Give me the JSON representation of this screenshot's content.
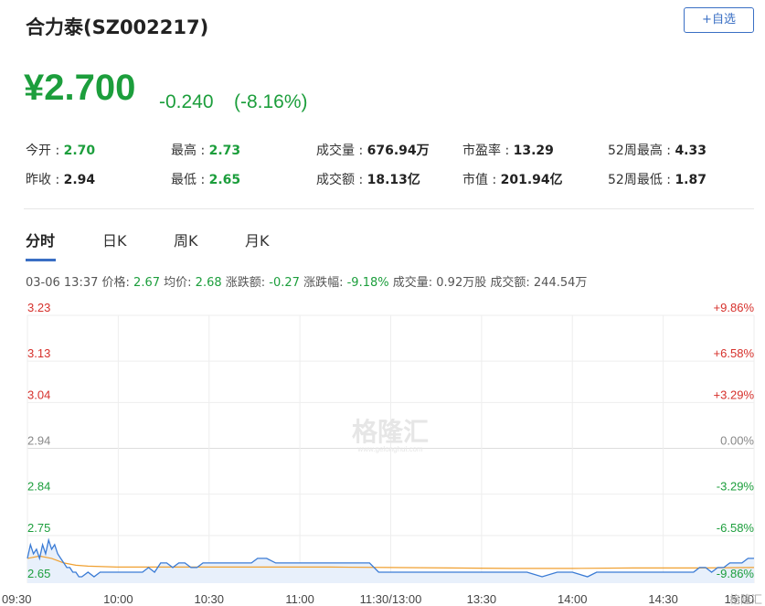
{
  "header": {
    "stock_name": "合力泰(SZ002217)",
    "add_fav_label": "+自选"
  },
  "quote": {
    "price": "¥2.700",
    "change": "-0.240",
    "change_pct": "(-8.16%)"
  },
  "stats": [
    {
      "label": "今开 : ",
      "value": "2.70",
      "green": true
    },
    {
      "label": "最高 : ",
      "value": "2.73",
      "green": true
    },
    {
      "label": "成交量 : ",
      "value": "676.94万",
      "green": false
    },
    {
      "label": "市盈率 : ",
      "value": "13.29",
      "green": false
    },
    {
      "label": "52周最高 : ",
      "value": "4.33",
      "green": false
    },
    {
      "label": "昨收 : ",
      "value": "2.94",
      "green": false
    },
    {
      "label": "最低 : ",
      "value": "2.65",
      "green": true
    },
    {
      "label": "成交额 : ",
      "value": "18.13亿",
      "green": false
    },
    {
      "label": "市值 : ",
      "value": "201.94亿",
      "green": false
    },
    {
      "label": "52周最低 : ",
      "value": "1.87",
      "green": false
    }
  ],
  "tabs": [
    "分时",
    "日K",
    "周K",
    "月K"
  ],
  "info_line": {
    "datetime": "03-06 13:37",
    "price_label": "价格:",
    "price_value": "2.67",
    "avg_label": "均价:",
    "avg_value": "2.68",
    "change_label": "涨跌额:",
    "change_value": "-0.27",
    "pct_label": "涨跌幅:",
    "pct_value": "-9.18%",
    "vol_label": "成交量:",
    "vol_value": "0.92万股",
    "amount_label": "成交额:",
    "amount_value": "244.54万"
  },
  "watermark": "格隆汇",
  "watermark_url": "www.gelonghui.com",
  "corner_logo": "格隆汇",
  "colors": {
    "up": "#d6302b",
    "down": "#1c9e3c",
    "neutral": "#888888",
    "price_line": "#3a7bd5",
    "avg_line": "#f0a030",
    "accent": "#3a6fc4"
  },
  "chart_data": {
    "type": "line",
    "y_ticks_left": [
      "3.23",
      "3.13",
      "3.04",
      "2.94",
      "2.84",
      "2.75",
      "2.65"
    ],
    "y_ticks_right": [
      "+9.86%",
      "+6.58%",
      "+3.29%",
      "0.00%",
      "-3.29%",
      "-6.58%",
      "-9.86%"
    ],
    "y_tick_values": [
      3.23,
      3.13,
      3.04,
      2.94,
      2.84,
      2.75,
      2.65
    ],
    "ylim": [
      2.646,
      3.23
    ],
    "x_ticks": [
      "09:30",
      "10:00",
      "10:30",
      "11:00",
      "11:30/13:00",
      "13:30",
      "14:00",
      "14:30",
      "15:00"
    ],
    "x_range_minutes": [
      0,
      240
    ],
    "series": [
      {
        "values": [
          [
            0,
            2.7
          ],
          [
            1,
            2.73
          ],
          [
            2,
            2.71
          ],
          [
            3,
            2.72
          ],
          [
            4,
            2.7
          ],
          [
            5,
            2.73
          ],
          [
            6,
            2.71
          ],
          [
            7,
            2.74
          ],
          [
            8,
            2.72
          ],
          [
            9,
            2.73
          ],
          [
            10,
            2.71
          ],
          [
            11,
            2.7
          ],
          [
            12,
            2.69
          ],
          [
            13,
            2.68
          ],
          [
            14,
            2.68
          ],
          [
            15,
            2.67
          ],
          [
            16,
            2.67
          ],
          [
            17,
            2.66
          ],
          [
            18,
            2.66
          ],
          [
            20,
            2.67
          ],
          [
            22,
            2.66
          ],
          [
            24,
            2.67
          ],
          [
            26,
            2.67
          ],
          [
            28,
            2.67
          ],
          [
            30,
            2.67
          ],
          [
            33,
            2.67
          ],
          [
            36,
            2.67
          ],
          [
            38,
            2.67
          ],
          [
            40,
            2.68
          ],
          [
            42,
            2.67
          ],
          [
            44,
            2.69
          ],
          [
            46,
            2.69
          ],
          [
            48,
            2.68
          ],
          [
            50,
            2.69
          ],
          [
            52,
            2.69
          ],
          [
            54,
            2.68
          ],
          [
            56,
            2.68
          ],
          [
            58,
            2.69
          ],
          [
            60,
            2.69
          ],
          [
            63,
            2.69
          ],
          [
            66,
            2.69
          ],
          [
            70,
            2.69
          ],
          [
            74,
            2.69
          ],
          [
            76,
            2.7
          ],
          [
            79,
            2.7
          ],
          [
            82,
            2.69
          ],
          [
            86,
            2.69
          ],
          [
            90,
            2.69
          ],
          [
            95,
            2.69
          ],
          [
            100,
            2.69
          ],
          [
            105,
            2.69
          ],
          [
            110,
            2.69
          ],
          [
            113,
            2.69
          ],
          [
            116,
            2.67
          ],
          [
            118,
            2.67
          ],
          [
            121,
            2.67
          ],
          [
            124,
            2.67
          ],
          [
            127,
            2.67
          ],
          [
            130,
            2.67
          ],
          [
            135,
            2.67
          ],
          [
            140,
            2.67
          ],
          [
            145,
            2.67
          ],
          [
            150,
            2.67
          ],
          [
            155,
            2.67
          ],
          [
            160,
            2.67
          ],
          [
            165,
            2.67
          ],
          [
            170,
            2.66
          ],
          [
            175,
            2.67
          ],
          [
            180,
            2.67
          ],
          [
            185,
            2.66
          ],
          [
            188,
            2.67
          ],
          [
            192,
            2.67
          ],
          [
            196,
            2.67
          ],
          [
            200,
            2.67
          ],
          [
            204,
            2.67
          ],
          [
            208,
            2.67
          ],
          [
            212,
            2.67
          ],
          [
            216,
            2.67
          ],
          [
            220,
            2.67
          ],
          [
            222,
            2.68
          ],
          [
            224,
            2.68
          ],
          [
            226,
            2.67
          ],
          [
            228,
            2.68
          ],
          [
            230,
            2.68
          ],
          [
            232,
            2.69
          ],
          [
            234,
            2.69
          ],
          [
            236,
            2.69
          ],
          [
            238,
            2.7
          ],
          [
            240,
            2.7
          ]
        ]
      },
      {
        "values": [
          [
            0,
            2.7
          ],
          [
            4,
            2.705
          ],
          [
            8,
            2.7
          ],
          [
            12,
            2.69
          ],
          [
            16,
            2.685
          ],
          [
            20,
            2.683
          ],
          [
            30,
            2.681
          ],
          [
            40,
            2.681
          ],
          [
            60,
            2.681
          ],
          [
            80,
            2.681
          ],
          [
            100,
            2.681
          ],
          [
            120,
            2.68
          ],
          [
            140,
            2.679
          ],
          [
            160,
            2.678
          ],
          [
            180,
            2.678
          ],
          [
            200,
            2.679
          ],
          [
            220,
            2.679
          ],
          [
            240,
            2.68
          ]
        ]
      }
    ]
  }
}
